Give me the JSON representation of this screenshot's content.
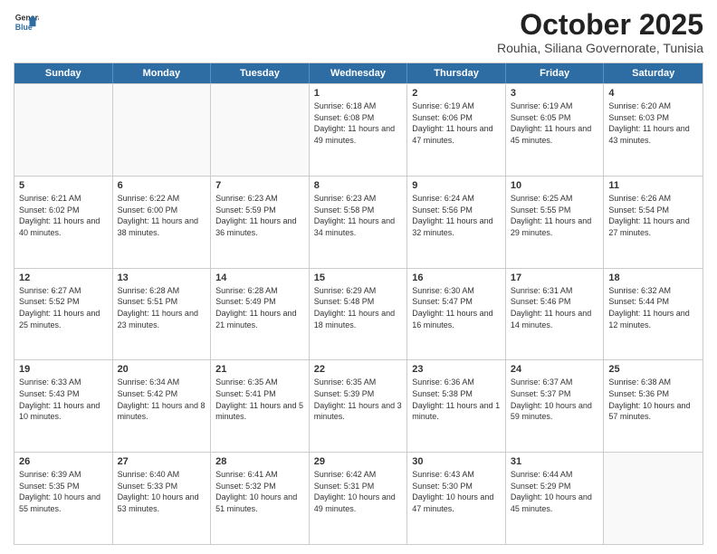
{
  "header": {
    "logo_line1": "General",
    "logo_line2": "Blue",
    "title": "October 2025",
    "subtitle": "Rouhia, Siliana Governorate, Tunisia"
  },
  "days_of_week": [
    "Sunday",
    "Monday",
    "Tuesday",
    "Wednesday",
    "Thursday",
    "Friday",
    "Saturday"
  ],
  "weeks": [
    [
      {
        "day": "",
        "info": ""
      },
      {
        "day": "",
        "info": ""
      },
      {
        "day": "",
        "info": ""
      },
      {
        "day": "1",
        "info": "Sunrise: 6:18 AM\nSunset: 6:08 PM\nDaylight: 11 hours and 49 minutes."
      },
      {
        "day": "2",
        "info": "Sunrise: 6:19 AM\nSunset: 6:06 PM\nDaylight: 11 hours and 47 minutes."
      },
      {
        "day": "3",
        "info": "Sunrise: 6:19 AM\nSunset: 6:05 PM\nDaylight: 11 hours and 45 minutes."
      },
      {
        "day": "4",
        "info": "Sunrise: 6:20 AM\nSunset: 6:03 PM\nDaylight: 11 hours and 43 minutes."
      }
    ],
    [
      {
        "day": "5",
        "info": "Sunrise: 6:21 AM\nSunset: 6:02 PM\nDaylight: 11 hours and 40 minutes."
      },
      {
        "day": "6",
        "info": "Sunrise: 6:22 AM\nSunset: 6:00 PM\nDaylight: 11 hours and 38 minutes."
      },
      {
        "day": "7",
        "info": "Sunrise: 6:23 AM\nSunset: 5:59 PM\nDaylight: 11 hours and 36 minutes."
      },
      {
        "day": "8",
        "info": "Sunrise: 6:23 AM\nSunset: 5:58 PM\nDaylight: 11 hours and 34 minutes."
      },
      {
        "day": "9",
        "info": "Sunrise: 6:24 AM\nSunset: 5:56 PM\nDaylight: 11 hours and 32 minutes."
      },
      {
        "day": "10",
        "info": "Sunrise: 6:25 AM\nSunset: 5:55 PM\nDaylight: 11 hours and 29 minutes."
      },
      {
        "day": "11",
        "info": "Sunrise: 6:26 AM\nSunset: 5:54 PM\nDaylight: 11 hours and 27 minutes."
      }
    ],
    [
      {
        "day": "12",
        "info": "Sunrise: 6:27 AM\nSunset: 5:52 PM\nDaylight: 11 hours and 25 minutes."
      },
      {
        "day": "13",
        "info": "Sunrise: 6:28 AM\nSunset: 5:51 PM\nDaylight: 11 hours and 23 minutes."
      },
      {
        "day": "14",
        "info": "Sunrise: 6:28 AM\nSunset: 5:49 PM\nDaylight: 11 hours and 21 minutes."
      },
      {
        "day": "15",
        "info": "Sunrise: 6:29 AM\nSunset: 5:48 PM\nDaylight: 11 hours and 18 minutes."
      },
      {
        "day": "16",
        "info": "Sunrise: 6:30 AM\nSunset: 5:47 PM\nDaylight: 11 hours and 16 minutes."
      },
      {
        "day": "17",
        "info": "Sunrise: 6:31 AM\nSunset: 5:46 PM\nDaylight: 11 hours and 14 minutes."
      },
      {
        "day": "18",
        "info": "Sunrise: 6:32 AM\nSunset: 5:44 PM\nDaylight: 11 hours and 12 minutes."
      }
    ],
    [
      {
        "day": "19",
        "info": "Sunrise: 6:33 AM\nSunset: 5:43 PM\nDaylight: 11 hours and 10 minutes."
      },
      {
        "day": "20",
        "info": "Sunrise: 6:34 AM\nSunset: 5:42 PM\nDaylight: 11 hours and 8 minutes."
      },
      {
        "day": "21",
        "info": "Sunrise: 6:35 AM\nSunset: 5:41 PM\nDaylight: 11 hours and 5 minutes."
      },
      {
        "day": "22",
        "info": "Sunrise: 6:35 AM\nSunset: 5:39 PM\nDaylight: 11 hours and 3 minutes."
      },
      {
        "day": "23",
        "info": "Sunrise: 6:36 AM\nSunset: 5:38 PM\nDaylight: 11 hours and 1 minute."
      },
      {
        "day": "24",
        "info": "Sunrise: 6:37 AM\nSunset: 5:37 PM\nDaylight: 10 hours and 59 minutes."
      },
      {
        "day": "25",
        "info": "Sunrise: 6:38 AM\nSunset: 5:36 PM\nDaylight: 10 hours and 57 minutes."
      }
    ],
    [
      {
        "day": "26",
        "info": "Sunrise: 6:39 AM\nSunset: 5:35 PM\nDaylight: 10 hours and 55 minutes."
      },
      {
        "day": "27",
        "info": "Sunrise: 6:40 AM\nSunset: 5:33 PM\nDaylight: 10 hours and 53 minutes."
      },
      {
        "day": "28",
        "info": "Sunrise: 6:41 AM\nSunset: 5:32 PM\nDaylight: 10 hours and 51 minutes."
      },
      {
        "day": "29",
        "info": "Sunrise: 6:42 AM\nSunset: 5:31 PM\nDaylight: 10 hours and 49 minutes."
      },
      {
        "day": "30",
        "info": "Sunrise: 6:43 AM\nSunset: 5:30 PM\nDaylight: 10 hours and 47 minutes."
      },
      {
        "day": "31",
        "info": "Sunrise: 6:44 AM\nSunset: 5:29 PM\nDaylight: 10 hours and 45 minutes."
      },
      {
        "day": "",
        "info": ""
      }
    ]
  ]
}
